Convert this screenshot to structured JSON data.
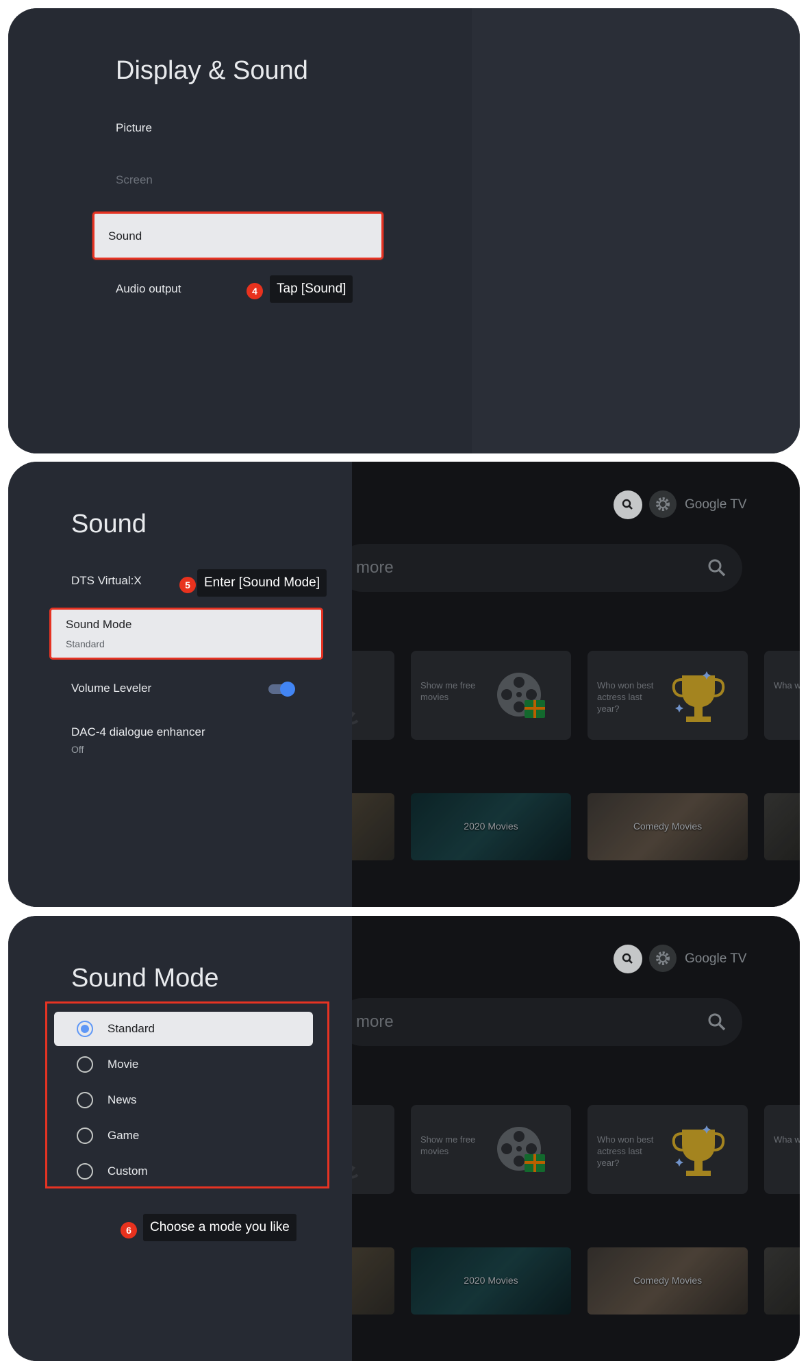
{
  "panel1": {
    "title": "Display & Sound",
    "items": [
      "Picture",
      "Screen",
      "Sound",
      "Audio output"
    ],
    "selected": "Sound",
    "step": {
      "number": "4",
      "text": "Tap [Sound]"
    }
  },
  "panel2": {
    "title": "Sound",
    "items": [
      {
        "label": "DTS Virtual:X"
      },
      {
        "label": "Sound Mode",
        "value": "Standard"
      },
      {
        "label": "Volume Leveler",
        "toggle": true
      },
      {
        "label": "DAC-4 dialogue enhancer",
        "value": "Off"
      }
    ],
    "step": {
      "number": "5",
      "text": "Enter [Sound Mode]"
    }
  },
  "panel3": {
    "title": "Sound Mode",
    "options": [
      "Standard",
      "Movie",
      "News",
      "Game",
      "Custom"
    ],
    "selected": "Standard",
    "step": {
      "number": "6",
      "text": "Choose a mode you like"
    }
  },
  "tv_background": {
    "logo": "Google TV",
    "search_placeholder": "more",
    "cards": [
      {
        "text": "Show me free movies",
        "icon": "film-reel-icon"
      },
      {
        "text": "Who won best actress last year?",
        "icon": "trophy-icon"
      },
      {
        "text": "Wha weat tomo",
        "icon": ""
      }
    ],
    "movie_rows": [
      "2020 Movies",
      "Comedy Movies"
    ],
    "icons": [
      "search-icon",
      "gear-icon"
    ]
  },
  "colors": {
    "highlight_border": "#e63323",
    "toggle_on": "#4285f4",
    "radio_on": "#5e97f6",
    "step_badge": "#e8321e",
    "panel_bg": "#262a33"
  }
}
